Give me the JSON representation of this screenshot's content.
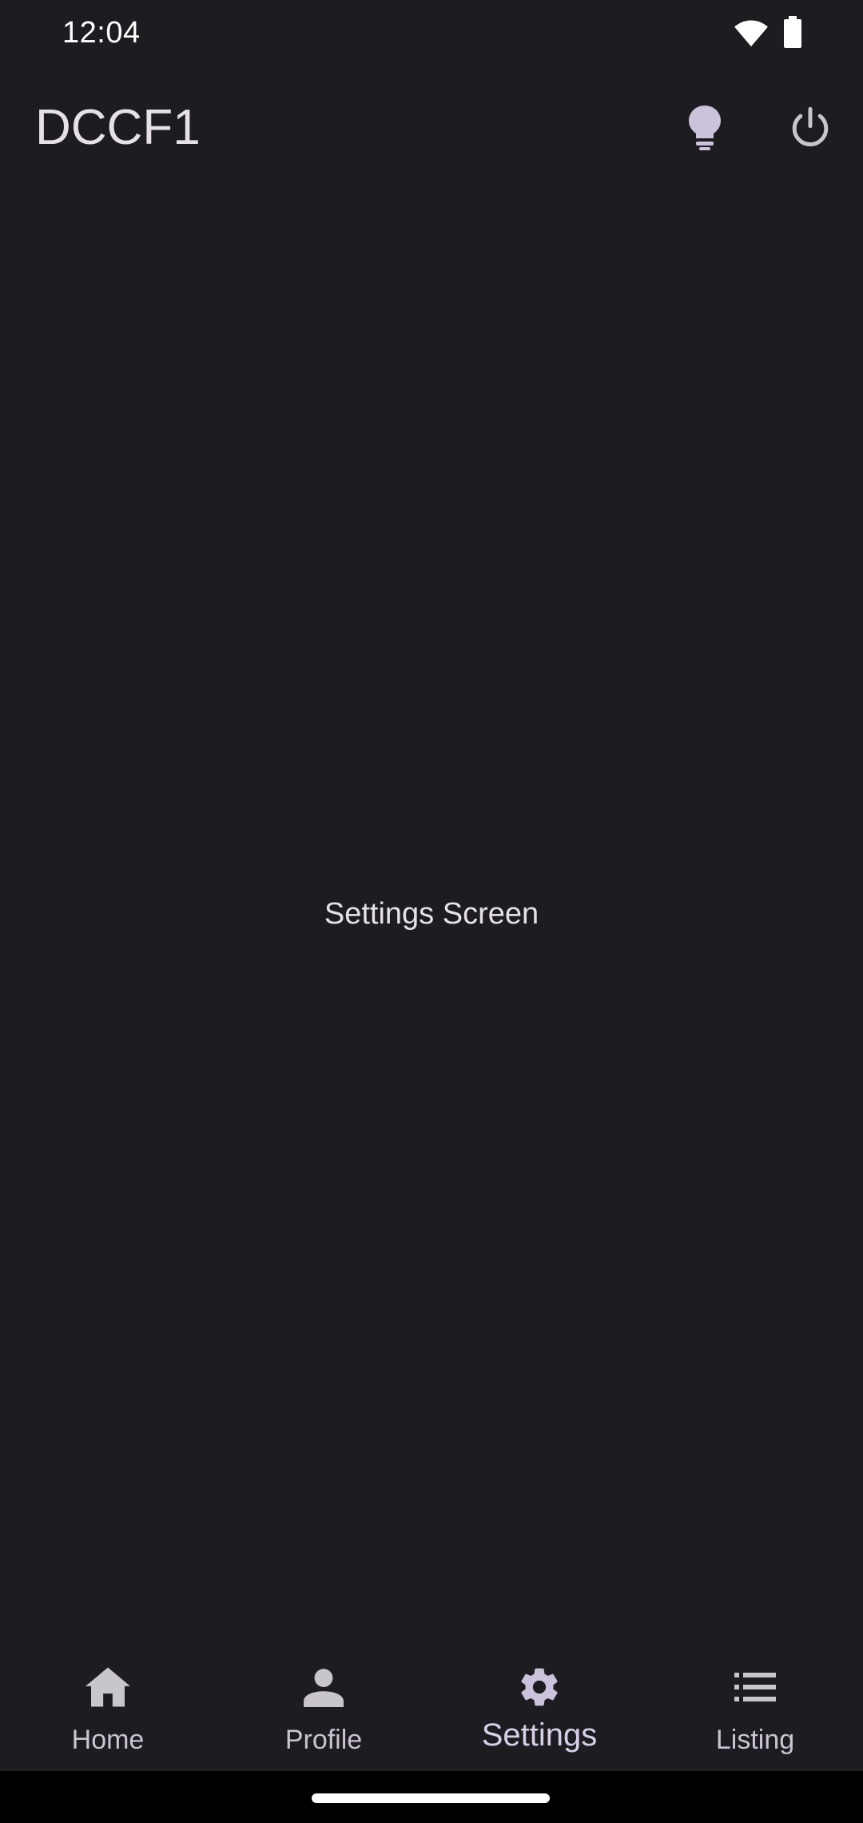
{
  "status_bar": {
    "time": "12:04",
    "icons": [
      "wifi-icon",
      "battery-icon"
    ]
  },
  "app_bar": {
    "title": "DCCF1",
    "actions": [
      "lightbulb-icon",
      "power-icon"
    ]
  },
  "content": {
    "text": "Settings Screen"
  },
  "bottom_nav": {
    "items": [
      {
        "label": "Home",
        "icon": "home-icon",
        "selected": false
      },
      {
        "label": "Profile",
        "icon": "person-icon",
        "selected": false
      },
      {
        "label": "Settings",
        "icon": "gear-icon",
        "selected": true
      },
      {
        "label": "Listing",
        "icon": "list-icon",
        "selected": false
      }
    ]
  },
  "colors": {
    "background": "#1d1c21",
    "on_surface": "#e6e1e6",
    "nav_icon": "#c9c5cc",
    "selected_icon": "#cbc2db"
  }
}
